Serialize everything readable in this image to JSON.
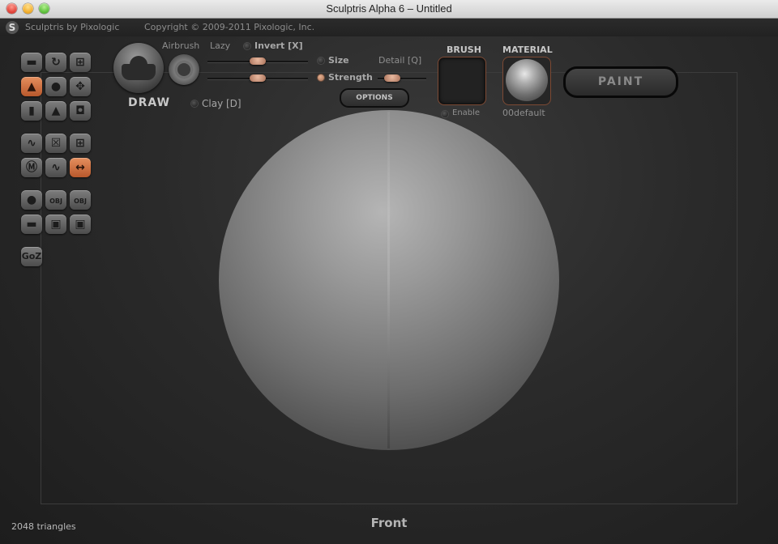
{
  "window": {
    "title": "Sculptris Alpha 6 – Untitled"
  },
  "header": {
    "app_name": "Sculptris by Pixologic",
    "copyright": "Copyright © 2009-2011 Pixologic, Inc."
  },
  "tools": {
    "groups": [
      [
        "sculpt-flatten-icon",
        "rotate-icon",
        "crop-icon",
        "draw-icon",
        "inflate-icon",
        "grab-icon",
        "pinch-icon",
        "crease-icon",
        "smooth-icon"
      ],
      [
        "symmetry-icon",
        "wireframe-icon",
        "grid-icon",
        "material-m-icon",
        "wave-icon",
        "flip-icon"
      ],
      [
        "new-sphere-icon",
        "import-obj-icon",
        "export-obj-icon",
        "plane-icon",
        "save-icon",
        "save-as-icon"
      ],
      [
        "goz-icon"
      ]
    ],
    "goz_label": "GoZ",
    "obj_label": "OBJ"
  },
  "brush_settings": {
    "draw_label": "DRAW",
    "airbrush_label": "Airbrush",
    "lazy_label": "Lazy",
    "invert_label": "Invert [X]",
    "size_label": "Size",
    "detail_label": "Detail [Q]",
    "strength_label": "Strength",
    "clay_label": "Clay [D]",
    "options_label": "OPTIONS",
    "size_value": 0.5,
    "strength_value": 0.5,
    "detail_value": 0.3
  },
  "brush_panel": {
    "title": "BRUSH",
    "enable_label": "Enable"
  },
  "material_panel": {
    "title": "MATERIAL",
    "name": "00default"
  },
  "paint_button": {
    "label": "PAINT"
  },
  "status": {
    "triangles": "2048 triangles",
    "view": "Front"
  },
  "colors": {
    "accent": "#c46a3c",
    "background": "#2a2a2a",
    "sphere": "#8a8a8a"
  }
}
